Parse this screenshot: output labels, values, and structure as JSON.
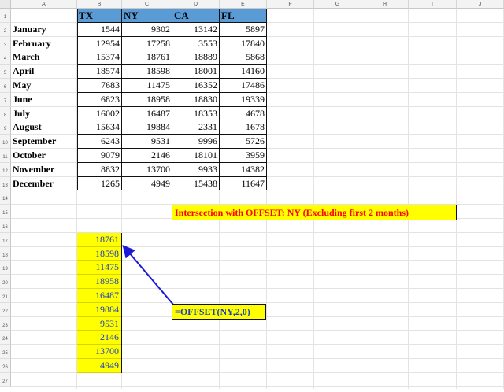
{
  "columns": [
    "A",
    "B",
    "C",
    "D",
    "E",
    "F",
    "G",
    "H",
    "I",
    "J"
  ],
  "rows": [
    "1",
    "2",
    "3",
    "4",
    "5",
    "6",
    "7",
    "8",
    "9",
    "10",
    "11",
    "12",
    "13",
    "14",
    "15",
    "16",
    "17",
    "18",
    "19",
    "20",
    "21",
    "22",
    "23",
    "24",
    "25",
    "26",
    "27"
  ],
  "table": {
    "headers": [
      "TX",
      "NY",
      "CA",
      "FL"
    ],
    "data": [
      {
        "month": "January",
        "values": [
          "1544",
          "9302",
          "13142",
          "5897"
        ]
      },
      {
        "month": "February",
        "values": [
          "12954",
          "17258",
          "3553",
          "17840"
        ]
      },
      {
        "month": "March",
        "values": [
          "15374",
          "18761",
          "18889",
          "5868"
        ]
      },
      {
        "month": "April",
        "values": [
          "18574",
          "18598",
          "18001",
          "14160"
        ]
      },
      {
        "month": "May",
        "values": [
          "7683",
          "11475",
          "16352",
          "17486"
        ]
      },
      {
        "month": "June",
        "values": [
          "6823",
          "18958",
          "18830",
          "19339"
        ]
      },
      {
        "month": "July",
        "values": [
          "16002",
          "16487",
          "18353",
          "4678"
        ]
      },
      {
        "month": "August",
        "values": [
          "15634",
          "19884",
          "2331",
          "1678"
        ]
      },
      {
        "month": "September",
        "values": [
          "6243",
          "9531",
          "9996",
          "5726"
        ]
      },
      {
        "month": "October",
        "values": [
          "9079",
          "2146",
          "18101",
          "3959"
        ]
      },
      {
        "month": "November",
        "values": [
          "8832",
          "13700",
          "9933",
          "14382"
        ]
      },
      {
        "month": "December",
        "values": [
          "1265",
          "4949",
          "15438",
          "11647"
        ]
      }
    ]
  },
  "note": "Intersection with OFFSET: NY (Excluding first 2 months)",
  "offset_results": [
    "18761",
    "18598",
    "11475",
    "18958",
    "16487",
    "19884",
    "9531",
    "2146",
    "13700",
    "4949"
  ],
  "formula": "=OFFSET(NY,2,0)",
  "colors": {
    "header_fill": "#5b9bd5",
    "highlight": "#ffff00",
    "note_text": "#ff0000",
    "formula_text": "#1f3fbf",
    "arrow": "#1a1ad6"
  }
}
